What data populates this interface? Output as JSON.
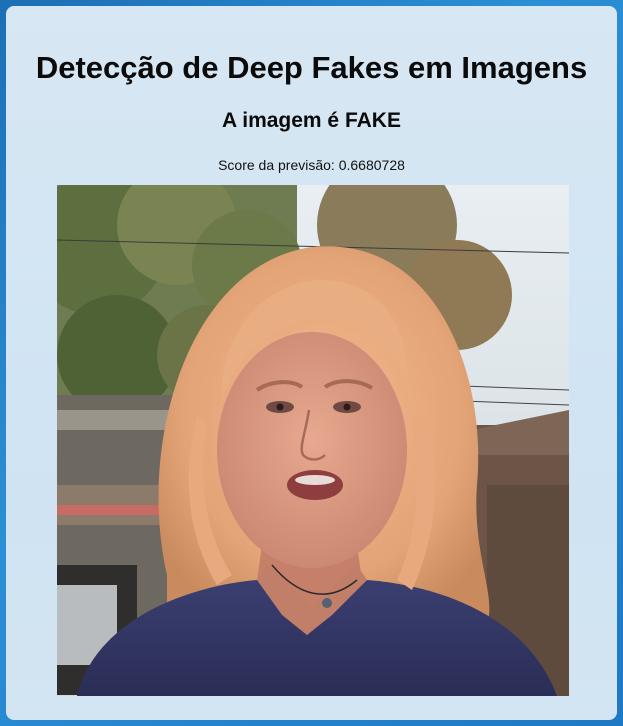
{
  "page": {
    "title": "Detecção de Deep Fakes em Imagens",
    "result_text": "A imagem é FAKE",
    "score_text": "Score da previsão: 0.6680728"
  },
  "image": {
    "subject": "analyzed-face-photo"
  },
  "colors": {
    "background": "#2b8fd6",
    "card": "#d4e6f3",
    "text": "#0b0b0b"
  }
}
